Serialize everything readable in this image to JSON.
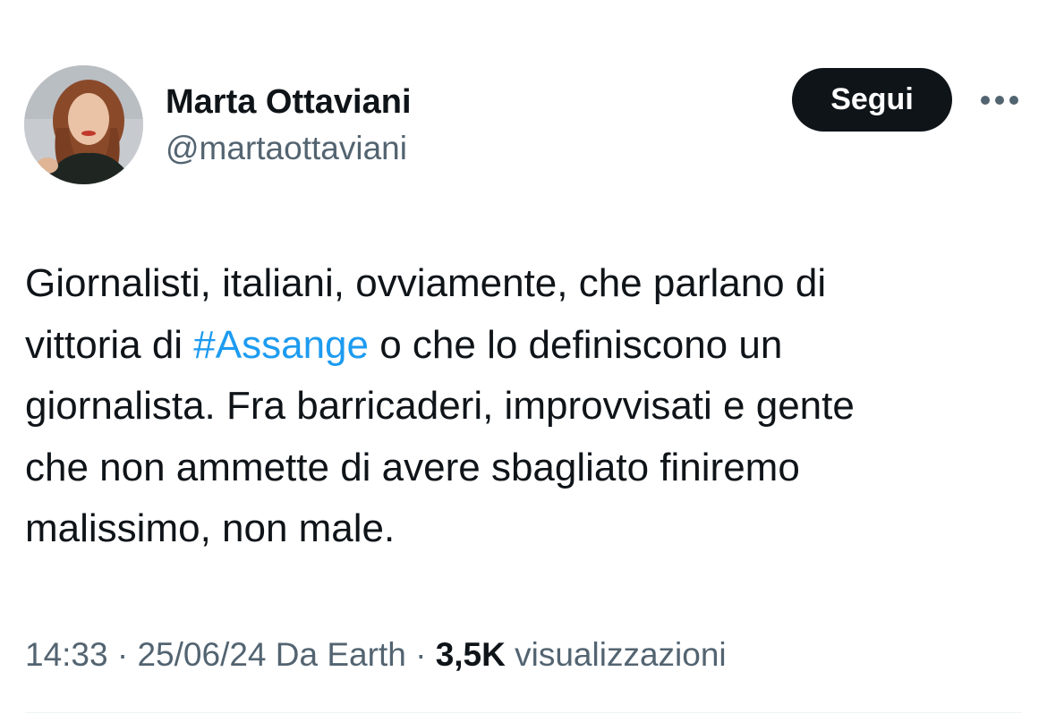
{
  "author": {
    "display_name": "Marta Ottaviani",
    "handle": "@martaottaviani"
  },
  "follow_button": {
    "label": "Segui"
  },
  "more_button": {
    "icon": "more-horizontal-icon"
  },
  "tweet": {
    "lines": [
      {
        "text": "Giornalisti, italiani, ovviamente, che parlano di"
      },
      {
        "before": "vittoria di ",
        "hashtag": "#Assange",
        "after": " o che lo definiscono un"
      },
      {
        "text": "giornalista. Fra barricaderi, improvvisati e gente"
      },
      {
        "text": "che non ammette di avere sbagliato finiremo"
      },
      {
        "text": "malissimo, non male."
      }
    ]
  },
  "meta": {
    "time": "14:33",
    "separator": " · ",
    "date": "25/06/24",
    "source": " Da Earth",
    "views_count": "3,5K",
    "views_label": " visualizzazioni"
  },
  "colors": {
    "text_primary": "#0f1419",
    "text_secondary": "#536471",
    "hashtag": "#1d9bf0",
    "button_bg": "#0f1419",
    "button_text": "#ffffff",
    "divider": "#eff3f4"
  }
}
